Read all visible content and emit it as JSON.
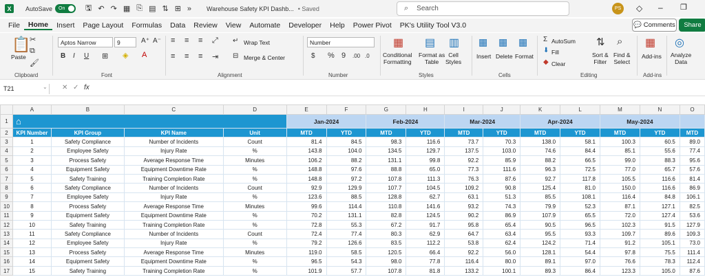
{
  "titlebar": {
    "app_letter": "X",
    "autosave": "AutoSave",
    "toggle": "On",
    "filename": "Warehouse Safety KPI Dashb...",
    "saved": "• Saved",
    "search": "Search",
    "avatar": "PS"
  },
  "menu": [
    "File",
    "Home",
    "Insert",
    "Page Layout",
    "Formulas",
    "Data",
    "Review",
    "View",
    "Automate",
    "Developer",
    "Help",
    "Power Pivot",
    "PK's Utility Tool V3.0"
  ],
  "buttons": {
    "comments": "Comments",
    "share": "Share"
  },
  "ribbon": {
    "clipboard": {
      "paste": "Paste",
      "label": "Clipboard"
    },
    "font": {
      "name": "Aptos Narrow",
      "size": "9",
      "label": "Font"
    },
    "alignment": {
      "wrap": "Wrap Text",
      "merge": "Merge & Center",
      "label": "Alignment"
    },
    "number": {
      "format": "Number",
      "label": "Number"
    },
    "styles": {
      "cond": "Conditional",
      "cond2": "Formatting",
      "fmt": "Format as",
      "fmt2": "Table",
      "cell": "Cell",
      "cell2": "Styles",
      "label": "Styles"
    },
    "cells": {
      "insert": "Insert",
      "delete": "Delete",
      "format": "Format",
      "label": "Cells"
    },
    "editing": {
      "autosum": "AutoSum",
      "fill": "Fill",
      "clear": "Clear",
      "sort": "Sort &",
      "sort2": "Filter",
      "find": "Find &",
      "find2": "Select",
      "label": "Editing"
    },
    "addins": {
      "addins": "Add-ins",
      "label": "Add-ins"
    },
    "analyze": {
      "a1": "Analyze",
      "a2": "Data"
    }
  },
  "formula": {
    "cell": "T21",
    "fx": "fx"
  },
  "columns": [
    "A",
    "B",
    "C",
    "D",
    "E",
    "F",
    "G",
    "H",
    "I",
    "J",
    "K",
    "L",
    "M",
    "N",
    "O"
  ],
  "months": [
    "Jan-2024",
    "Feb-2024",
    "Mar-2024",
    "Apr-2024",
    "May-2024"
  ],
  "headers": {
    "num": "KPI Number",
    "group": "KPI Group",
    "name": "KPI Name",
    "unit": "Unit",
    "mtd": "MTD",
    "ytd": "YTD"
  },
  "rows": [
    [
      "1",
      "Safety Compliance",
      "Number of Incidents",
      "Count",
      "81.4",
      "84.5",
      "98.3",
      "116.6",
      "73.7",
      "70.3",
      "138.0",
      "58.1",
      "100.3",
      "60.5",
      "89.0"
    ],
    [
      "2",
      "Employee Safety",
      "Injury Rate",
      "%",
      "143.8",
      "104.0",
      "134.5",
      "129.7",
      "137.5",
      "103.0",
      "74.6",
      "84.4",
      "85.1",
      "55.6",
      "77.4"
    ],
    [
      "3",
      "Process Safety",
      "Average Response Time",
      "Minutes",
      "106.2",
      "88.2",
      "131.1",
      "99.8",
      "92.2",
      "85.9",
      "88.2",
      "66.5",
      "99.0",
      "88.3",
      "95.6"
    ],
    [
      "4",
      "Equipment Safety",
      "Equipment Downtime Rate",
      "%",
      "148.8",
      "97.6",
      "88.8",
      "65.0",
      "77.3",
      "111.6",
      "96.3",
      "72.5",
      "77.0",
      "65.7",
      "57.6"
    ],
    [
      "5",
      "Safety Training",
      "Training Completion Rate",
      "%",
      "148.8",
      "97.2",
      "107.8",
      "111.3",
      "76.3",
      "87.6",
      "92.7",
      "117.8",
      "105.5",
      "116.6",
      "81.4"
    ],
    [
      "6",
      "Safety Compliance",
      "Number of Incidents",
      "Count",
      "92.9",
      "129.9",
      "107.7",
      "104.5",
      "109.2",
      "90.8",
      "125.4",
      "81.0",
      "150.0",
      "116.6",
      "86.9"
    ],
    [
      "7",
      "Employee Safety",
      "Injury Rate",
      "%",
      "123.6",
      "88.5",
      "128.8",
      "62.7",
      "63.1",
      "51.3",
      "85.5",
      "108.1",
      "116.4",
      "84.8",
      "106.1"
    ],
    [
      "8",
      "Process Safety",
      "Average Response Time",
      "Minutes",
      "99.6",
      "114.4",
      "110.8",
      "141.6",
      "93.2",
      "74.3",
      "79.9",
      "52.3",
      "87.1",
      "127.1",
      "82.5"
    ],
    [
      "9",
      "Equipment Safety",
      "Equipment Downtime Rate",
      "%",
      "70.2",
      "131.1",
      "82.8",
      "124.5",
      "90.2",
      "86.9",
      "107.9",
      "65.5",
      "72.0",
      "127.4",
      "53.6"
    ],
    [
      "10",
      "Safety Training",
      "Training Completion Rate",
      "%",
      "72.8",
      "55.3",
      "67.2",
      "91.7",
      "95.8",
      "65.4",
      "90.5",
      "96.5",
      "102.3",
      "91.5",
      "127.9"
    ],
    [
      "11",
      "Safety Compliance",
      "Number of Incidents",
      "Count",
      "72.4",
      "77.4",
      "80.3",
      "62.9",
      "64.7",
      "63.4",
      "95.5",
      "93.3",
      "109.7",
      "89.6",
      "109.3"
    ],
    [
      "12",
      "Employee Safety",
      "Injury Rate",
      "%",
      "79.2",
      "126.6",
      "83.5",
      "112.2",
      "53.8",
      "62.4",
      "124.2",
      "71.4",
      "91.2",
      "105.1",
      "73.0"
    ],
    [
      "13",
      "Process Safety",
      "Average Response Time",
      "Minutes",
      "119.0",
      "58.5",
      "120.5",
      "66.4",
      "92.2",
      "56.0",
      "128.1",
      "54.4",
      "97.8",
      "75.5",
      "111.4"
    ],
    [
      "14",
      "Equipment Safety",
      "Equipment Downtime Rate",
      "%",
      "96.5",
      "54.3",
      "98.0",
      "77.8",
      "116.4",
      "80.0",
      "89.1",
      "97.0",
      "76.6",
      "78.3",
      "112.4"
    ],
    [
      "15",
      "Safety Training",
      "Training Completion Rate",
      "%",
      "101.9",
      "57.7",
      "107.8",
      "81.8",
      "133.2",
      "100.1",
      "89.3",
      "86.4",
      "123.3",
      "105.0",
      "87.6"
    ]
  ]
}
